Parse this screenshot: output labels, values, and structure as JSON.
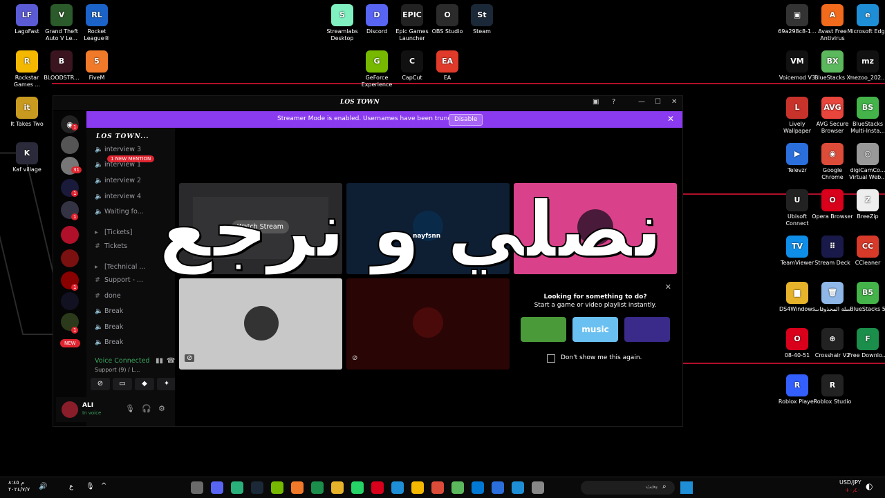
{
  "desktop": {
    "icons_left": [
      {
        "label": "LagoFast",
        "color": "#5b5bd6",
        "glyph": "LF"
      },
      {
        "label": "Grand Theft Auto V Le...",
        "color": "#2b5a2b",
        "glyph": "V"
      },
      {
        "label": "Rocket League®",
        "color": "#1b63c9",
        "glyph": "RL"
      },
      {
        "label": "Rockstar Games ...",
        "color": "#f5b800",
        "glyph": "R"
      },
      {
        "label": "BLOODSTR...",
        "color": "#3a1520",
        "glyph": "B"
      },
      {
        "label": "FiveM",
        "color": "#f07a2a",
        "glyph": "5"
      },
      {
        "label": "It Takes Two",
        "color": "#c99a20",
        "glyph": "it"
      },
      {
        "label": "Kaf village",
        "color": "#2a2a3a",
        "glyph": "K"
      }
    ],
    "icons_top": [
      {
        "label": "Streamlabs Desktop",
        "color": "#80f0c0",
        "glyph": "S"
      },
      {
        "label": "Discord",
        "color": "#5865f2",
        "glyph": "D"
      },
      {
        "label": "Epic Games Launcher",
        "color": "#222",
        "glyph": "EPIC"
      },
      {
        "label": "OBS Studio",
        "color": "#2b2b2b",
        "glyph": "O"
      },
      {
        "label": "Steam",
        "color": "#1b2838",
        "glyph": "St"
      },
      {
        "label": "GeForce Experience",
        "color": "#76b900",
        "glyph": "G"
      },
      {
        "label": "CapCut",
        "color": "#111",
        "glyph": "C"
      },
      {
        "label": "EA",
        "color": "#e03a2a",
        "glyph": "EA"
      }
    ],
    "icons_right": [
      {
        "label": "69a298c8-1...",
        "color": "#333",
        "glyph": "▣"
      },
      {
        "label": "Avast Free Antivirus",
        "color": "#f26b1d",
        "glyph": "A"
      },
      {
        "label": "Microsoft Edge",
        "color": "#1e8fd6",
        "glyph": "e"
      },
      {
        "label": "Voicemod V3",
        "color": "#111",
        "glyph": "VM"
      },
      {
        "label": "BlueStacks X",
        "color": "#5cb85c",
        "glyph": "BX"
      },
      {
        "label": "mezoo_202...",
        "color": "#111",
        "glyph": "mz"
      },
      {
        "label": "Lively Wallpaper",
        "color": "#c7332b",
        "glyph": "L"
      },
      {
        "label": "AVG Secure Browser",
        "color": "#e8453c",
        "glyph": "AVG"
      },
      {
        "label": "BlueStacks Multi-Insta...",
        "color": "#44b34a",
        "glyph": "BS"
      },
      {
        "label": "Televzr",
        "color": "#2a6fdb",
        "glyph": "▶"
      },
      {
        "label": "Google Chrome",
        "color": "#dd4b39",
        "glyph": "◉"
      },
      {
        "label": "digiCamCo... Virtual Web...",
        "color": "#999",
        "glyph": "◎"
      },
      {
        "label": "Ubisoft Connect",
        "color": "#222",
        "glyph": "U"
      },
      {
        "label": "Opera Browser",
        "color": "#d8001b",
        "glyph": "O"
      },
      {
        "label": "BreeZip",
        "color": "#eee",
        "glyph": "Z"
      },
      {
        "label": "TeamViewer",
        "color": "#0e8ee9",
        "glyph": "TV"
      },
      {
        "label": "Stream Deck",
        "color": "#1a1a4a",
        "glyph": "⠿"
      },
      {
        "label": "CCleaner",
        "color": "#d83a2a",
        "glyph": "CC"
      },
      {
        "label": "DS4Windows",
        "color": "#e6b32a",
        "glyph": "▆"
      },
      {
        "label": "سلة المحذوفات",
        "color": "#8fb8e8",
        "glyph": "🗑"
      },
      {
        "label": "BlueStacks 5",
        "color": "#44b34a",
        "glyph": "B5"
      },
      {
        "label": "08-40-51",
        "color": "#d8001b",
        "glyph": "O"
      },
      {
        "label": "Crosshair V2",
        "color": "#222",
        "glyph": "⊕"
      },
      {
        "label": "Free Downlo...",
        "color": "#1a8e4a",
        "glyph": "F"
      },
      {
        "label": "Roblox Player",
        "color": "#335fff",
        "glyph": "R"
      },
      {
        "label": "Roblox Studio",
        "color": "#222",
        "glyph": "R"
      }
    ]
  },
  "discord": {
    "window_title": "LOS TOWN",
    "banner_text": "Streamer Mode is enabled. Usernames have been truncated.",
    "banner_button": "Disable",
    "server_name": "LOS TOWN...",
    "new_mention": "1 NEW MENTION",
    "new_badge": "NEW",
    "channels": [
      {
        "icon": "🔈",
        "name": "interview 3"
      },
      {
        "icon": "🔈",
        "name": "interview 1"
      },
      {
        "icon": "🔈",
        "name": "interview 2"
      },
      {
        "icon": "🔈",
        "name": "interview 4"
      },
      {
        "icon": "🔈",
        "name": "Waiting fo..."
      },
      {
        "icon": "▸",
        "name": "[Tickets]"
      },
      {
        "icon": "#",
        "name": "Tickets"
      },
      {
        "icon": "▸",
        "name": "[Technical ..."
      },
      {
        "icon": "#",
        "name": "Support - ..."
      },
      {
        "icon": "#",
        "name": "done"
      },
      {
        "icon": "🔈",
        "name": "Break"
      },
      {
        "icon": "🔈",
        "name": "Break"
      },
      {
        "icon": "🔈",
        "name": "Break"
      }
    ],
    "guild_badges": [
      "1",
      "31",
      "1",
      "1",
      "1",
      "1"
    ],
    "voice_connected": "Voice Connected",
    "voice_sub": "Support (9) / L...",
    "user_name": "ALI",
    "user_status": "In voice",
    "watch_stream": "Watch Stream",
    "tile_user": "nayfsnn",
    "looking_title": "Looking for something to do?",
    "looking_sub": "Start a game or video playlist instantly.",
    "dont_show": "Don't show me this again.",
    "activity_music": "music"
  },
  "overlay_text": "نصلي و نرجع",
  "taskbar": {
    "search_placeholder": "بحث",
    "currency": "USD/JPY",
    "currency_change": "+٠٫٤٠",
    "time": "م ٨:٤٥",
    "date": "٢٠٢٤/٧/٧",
    "lang": "ع"
  },
  "colors": {
    "accent": "#8a3bf0",
    "discord": "#5865f2",
    "voice_green": "#3ba55c",
    "badge_red": "#e0242f",
    "pink_tile": "#d9428a"
  }
}
